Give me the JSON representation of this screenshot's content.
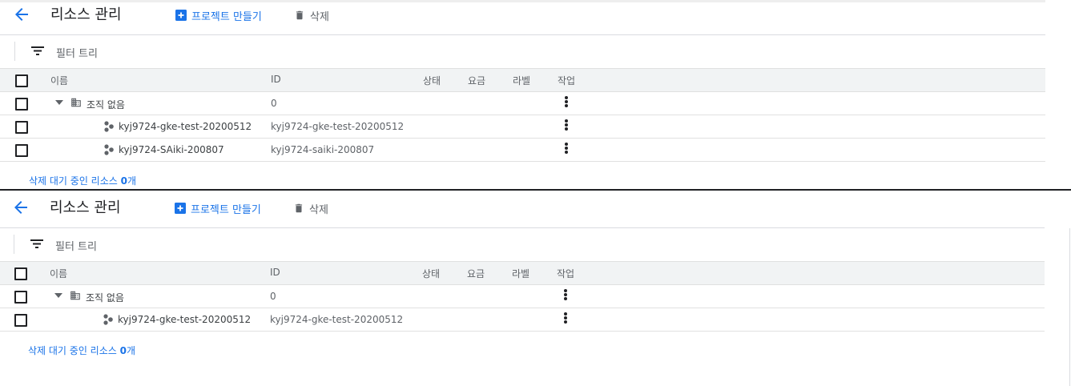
{
  "header": {
    "title": "리소스 관리",
    "create_label": "프로젝트 만들기",
    "delete_label": "삭제"
  },
  "filter": {
    "label": "필터 트리"
  },
  "table": {
    "columns": {
      "name": "이름",
      "id": "ID",
      "state": "상태",
      "fee": "요금",
      "label": "라벨",
      "action": "작업"
    },
    "org": {
      "name": "조직 없음",
      "id": "0"
    },
    "projects": [
      {
        "name": "kyj9724-gke-test-20200512",
        "id": "kyj9724-gke-test-20200512"
      },
      {
        "name": "kyj9724-SAiki-200807",
        "id": "kyj9724-saiki-200807"
      }
    ]
  },
  "pending": {
    "prefix": "삭제 대기 중인 리소스 ",
    "count": "0",
    "suffix": "개"
  },
  "colors": {
    "accent": "#1a73e8",
    "header_bg": "#f1f3f4",
    "divider": "#e0e0e0"
  },
  "icons": [
    "back-arrow-icon",
    "add-box-icon",
    "trash-icon",
    "filter-list-icon",
    "building-icon",
    "project-dots-icon",
    "more-vert-icon",
    "caret-down-icon"
  ]
}
